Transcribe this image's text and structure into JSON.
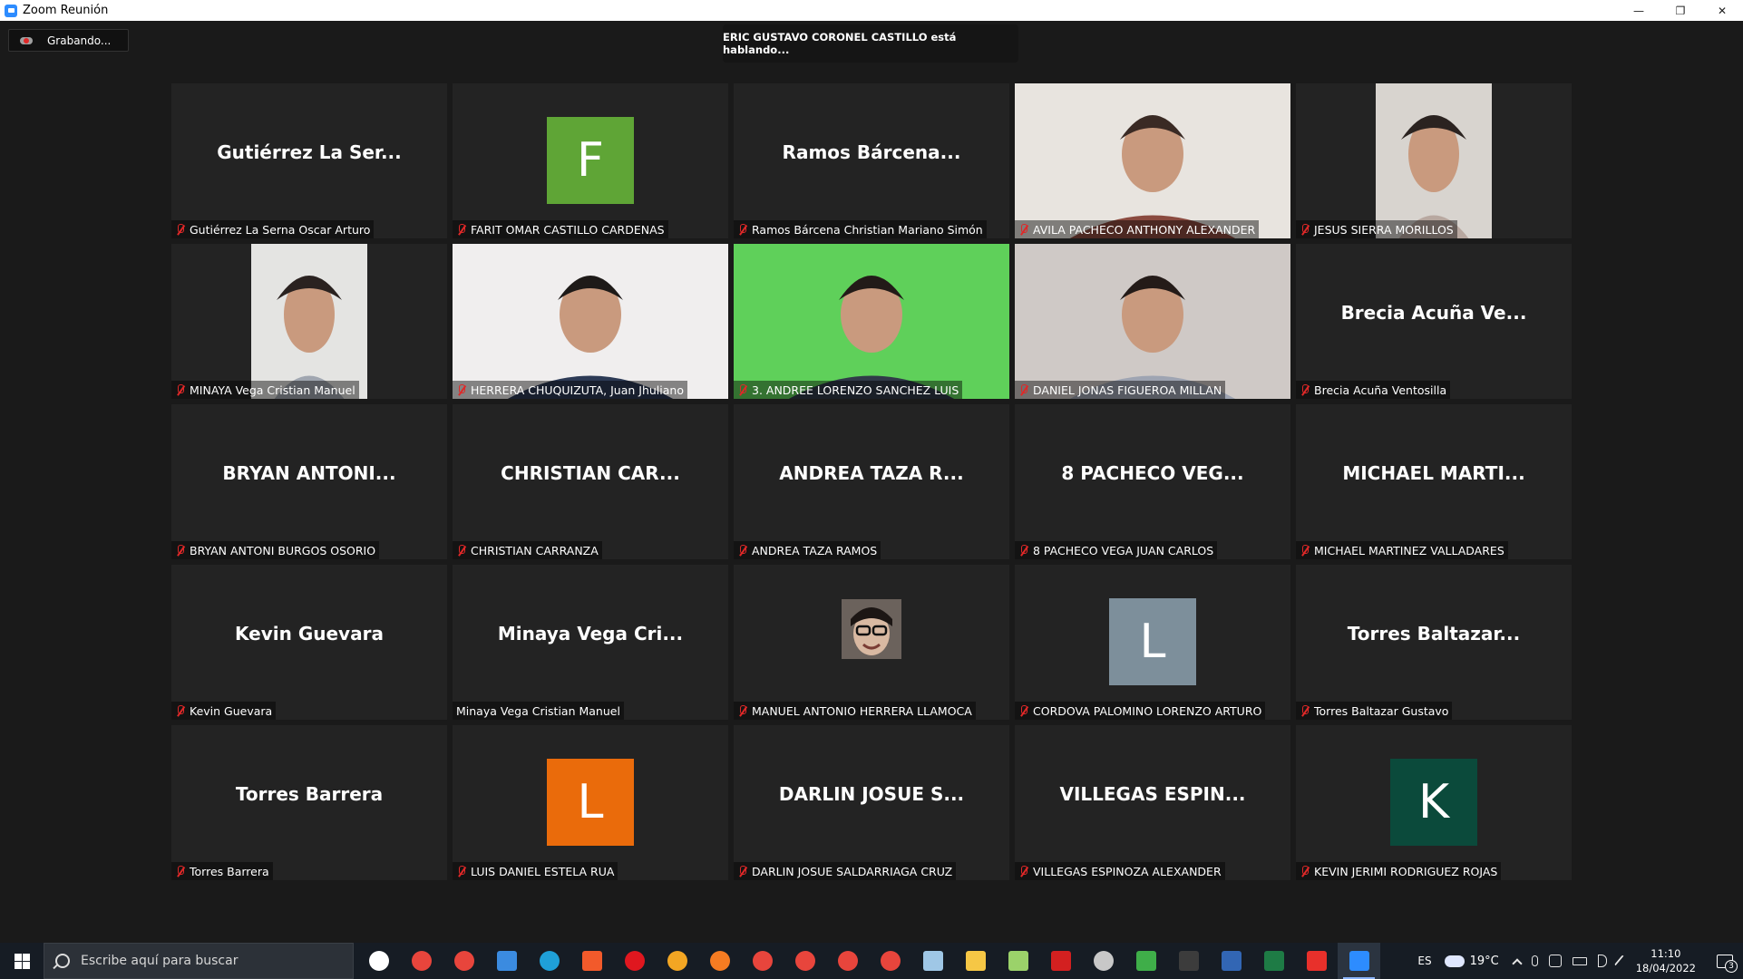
{
  "window": {
    "title": "Zoom Reunión",
    "minimize": "—",
    "restore": "❐",
    "close": "✕"
  },
  "recording": {
    "label": "Grabando..."
  },
  "speaker_banner": "ERIC GUSTAVO CORONEL CASTILLO está hablando...",
  "tiles": [
    {
      "kind": "name",
      "big": "Gutiérrez La Ser...",
      "label": "Gutiérrez La Serna Oscar Arturo",
      "muted": true
    },
    {
      "kind": "avatar",
      "letter": "F",
      "color": "#5fa536",
      "label": "FARIT OMAR CASTILLO CARDENAS",
      "muted": true
    },
    {
      "kind": "name",
      "big": "Ramos Bárcena...",
      "label": "Ramos Bárcena Christian Mariano Simón",
      "muted": true
    },
    {
      "kind": "video",
      "label": "AVILA PACHECO ANTHONY ALEXANDER",
      "muted": true
    },
    {
      "kind": "video-narrow",
      "label": "JESUS SIERRA MORILLOS",
      "muted": true
    },
    {
      "kind": "video-narrow",
      "label": "MINAYA Vega Cristian Manuel",
      "muted": true
    },
    {
      "kind": "video",
      "label": "HERRERA CHUQUIZUTA, Juan Jhuliano",
      "muted": true
    },
    {
      "kind": "video",
      "label": "3. ANDREE LORENZO SANCHEZ LUIS",
      "muted": true
    },
    {
      "kind": "video",
      "label": "DANIEL JONAS FIGUEROA MILLAN",
      "muted": true
    },
    {
      "kind": "name",
      "big": "Brecia Acuña Ve...",
      "label": "Brecia Acuña Ventosilla",
      "muted": true
    },
    {
      "kind": "name",
      "big": "BRYAN  ANTONI...",
      "label": "BRYAN ANTONI BURGOS OSORIO",
      "muted": true
    },
    {
      "kind": "name",
      "big": "CHRISTIAN  CAR...",
      "label": "CHRISTIAN CARRANZA",
      "muted": true
    },
    {
      "kind": "name",
      "big": "ANDREA  TAZA  R...",
      "label": "ANDREA TAZA RAMOS",
      "muted": true
    },
    {
      "kind": "name",
      "big": "8 PACHECO VEG...",
      "label": "8 PACHECO VEGA JUAN CARLOS",
      "muted": true
    },
    {
      "kind": "name",
      "big": "MICHAEL  MARTI...",
      "label": "MICHAEL MARTINEZ VALLADARES",
      "muted": true
    },
    {
      "kind": "name",
      "big": "Kevin Guevara",
      "label": "Kevin Guevara",
      "muted": true
    },
    {
      "kind": "name",
      "big": "Minaya Vega Cri...",
      "label": "Minaya Vega Cristian Manuel",
      "muted": false
    },
    {
      "kind": "photo",
      "label": "MANUEL ANTONIO HERRERA LLAMOCA",
      "muted": true
    },
    {
      "kind": "avatar",
      "letter": "L",
      "color": "#7d8f9b",
      "label": "CORDOVA PALOMINO LORENZO ARTURO",
      "muted": true
    },
    {
      "kind": "name",
      "big": "Torres Baltazar...",
      "label": "Torres Baltazar Gustavo",
      "muted": true
    },
    {
      "kind": "name",
      "big": "Torres Barrera",
      "label": "Torres Barrera",
      "muted": true
    },
    {
      "kind": "avatar",
      "letter": "L",
      "color": "#ea6b0b",
      "label": "LUIS DANIEL ESTELA RUA",
      "muted": true
    },
    {
      "kind": "name",
      "big": "DARLIN JOSUE S...",
      "label": "DARLIN JOSUE SALDARRIAGA CRUZ",
      "muted": true
    },
    {
      "kind": "name",
      "big": "VILLEGAS  ESPIN...",
      "label": "VILLEGAS ESPINOZA ALEXANDER",
      "muted": true
    },
    {
      "kind": "avatar",
      "letter": "K",
      "color": "#0b4a3b",
      "label": "KEVIN JERIMI RODRIGUEZ ROJAS",
      "muted": true
    }
  ],
  "taskbar": {
    "search_placeholder": "Escribe aquí para buscar",
    "apps": [
      {
        "name": "cortana-icon",
        "color": "#ffffff",
        "shape": "dot"
      },
      {
        "name": "chrome-icon",
        "color": "#e8453c",
        "shape": "dot"
      },
      {
        "name": "chrome-profile-icon",
        "color": "#e8453c",
        "shape": "dot"
      },
      {
        "name": "mail-icon",
        "color": "#3b8be0",
        "shape": "sq"
      },
      {
        "name": "edge-icon",
        "color": "#1fa0d8",
        "shape": "dot"
      },
      {
        "name": "brave-icon",
        "color": "#f25a2b",
        "shape": "sq"
      },
      {
        "name": "opera-icon",
        "color": "#e0171f",
        "shape": "dot"
      },
      {
        "name": "vivaldi-icon",
        "color": "#f3a623",
        "shape": "dot"
      },
      {
        "name": "firefox-icon",
        "color": "#f57c22",
        "shape": "dot"
      },
      {
        "name": "chrome-profile-2-icon",
        "color": "#e8453c",
        "shape": "dot"
      },
      {
        "name": "chrome-profile-3-icon",
        "color": "#e8453c",
        "shape": "dot"
      },
      {
        "name": "chrome-profile-4-icon",
        "color": "#e8453c",
        "shape": "dot"
      },
      {
        "name": "chrome-profile-5-icon",
        "color": "#e8453c",
        "shape": "dot"
      },
      {
        "name": "paint-icon",
        "color": "#9fc7e6",
        "shape": "sq"
      },
      {
        "name": "file-explorer-icon",
        "color": "#f6c745",
        "shape": "sq"
      },
      {
        "name": "notepad-icon",
        "color": "#9bd26a",
        "shape": "sq"
      },
      {
        "name": "acrobat-icon",
        "color": "#d32020",
        "shape": "sq"
      },
      {
        "name": "settings-icon",
        "color": "#c8c8c8",
        "shape": "dot"
      },
      {
        "name": "snipping-icon",
        "color": "#3fae49",
        "shape": "sq"
      },
      {
        "name": "terminal-icon",
        "color": "#3c3c3c",
        "shape": "sq"
      },
      {
        "name": "dev-icon",
        "color": "#3266b4",
        "shape": "sq"
      },
      {
        "name": "spreadsheet-icon",
        "color": "#1e7b45",
        "shape": "sq"
      },
      {
        "name": "anydesk-icon",
        "color": "#e8302b",
        "shape": "sq"
      },
      {
        "name": "zoom-icon",
        "color": "#2d8cff",
        "shape": "sq"
      }
    ],
    "tray": {
      "lang": "ES",
      "temperature": "19°C",
      "time": "11:10",
      "date": "18/04/2022",
      "notifications": "3"
    }
  }
}
